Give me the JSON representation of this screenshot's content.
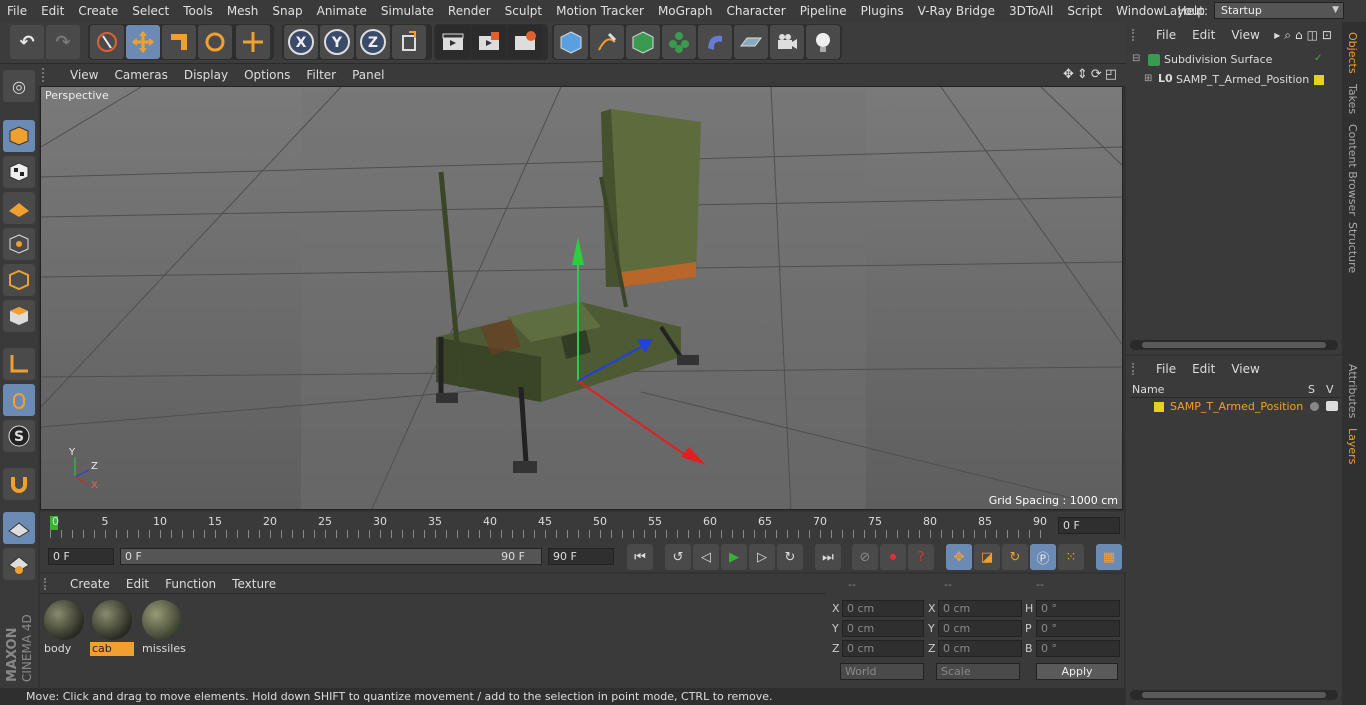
{
  "menu": [
    "File",
    "Edit",
    "Create",
    "Select",
    "Tools",
    "Mesh",
    "Snap",
    "Animate",
    "Simulate",
    "Render",
    "Sculpt",
    "Motion Tracker",
    "MoGraph",
    "Character",
    "Pipeline",
    "Plugins",
    "V-Ray Bridge",
    "3DToAll",
    "Script",
    "Window",
    "Help"
  ],
  "layout": {
    "label": "Layout:",
    "value": "Startup"
  },
  "viewport": {
    "menu": [
      "View",
      "Cameras",
      "Display",
      "Options",
      "Filter",
      "Panel"
    ],
    "camera": "Perspective",
    "grid_spacing": "Grid Spacing : 1000 cm",
    "axis_labels": {
      "y": "Y",
      "z": "Z",
      "x": "X"
    }
  },
  "timeline": {
    "ticks": [
      "0",
      "5",
      "10",
      "15",
      "20",
      "25",
      "30",
      "35",
      "40",
      "45",
      "50",
      "55",
      "60",
      "65",
      "70",
      "75",
      "80",
      "85",
      "90"
    ],
    "current_frame": "0 F"
  },
  "transport": {
    "start": "0 F",
    "range_start": "0 F",
    "range_end": "90 F",
    "end": "90 F"
  },
  "materials": {
    "menu": [
      "Create",
      "Edit",
      "Function",
      "Texture"
    ],
    "items": [
      {
        "name": "body"
      },
      {
        "name": "cab"
      },
      {
        "name": "missiles"
      }
    ],
    "selected": "cab"
  },
  "coords": {
    "headers": [
      "--",
      "--",
      "--"
    ],
    "rows": [
      {
        "l1": "X",
        "v1": "0 cm",
        "l2": "X",
        "v2": "0 cm",
        "l3": "H",
        "v3": "0 °"
      },
      {
        "l1": "Y",
        "v1": "0 cm",
        "l2": "Y",
        "v2": "0 cm",
        "l3": "P",
        "v3": "0 °"
      },
      {
        "l1": "Z",
        "v1": "0 cm",
        "l2": "Z",
        "v2": "0 cm",
        "l3": "B",
        "v3": "0 °"
      }
    ],
    "mode1": "World",
    "mode2": "Scale",
    "apply": "Apply"
  },
  "status": "Move: Click and drag to move elements. Hold down SHIFT to quantize movement / add to the selection in point mode, CTRL to remove.",
  "objects": {
    "menu": [
      "File",
      "Edit",
      "View"
    ],
    "items": [
      {
        "name": "Subdivision Surface"
      },
      {
        "name": "SAMP_T_Armed_Position"
      }
    ]
  },
  "layers": {
    "menu": [
      "File",
      "Edit",
      "View"
    ],
    "col_name": "Name",
    "col_s": "S",
    "col_v": "V",
    "items": [
      {
        "name": "SAMP_T_Armed_Position"
      }
    ]
  },
  "side_tabs": [
    "Objects",
    "Takes",
    "Content Browser",
    "Structure",
    "Attributes",
    "Layers"
  ],
  "brand": "MAXON CINEMA 4D",
  "colors": {
    "accent": "#f0a030",
    "selected_tool": "#6b8bb5",
    "layer_yellow": "#e6d21e"
  }
}
